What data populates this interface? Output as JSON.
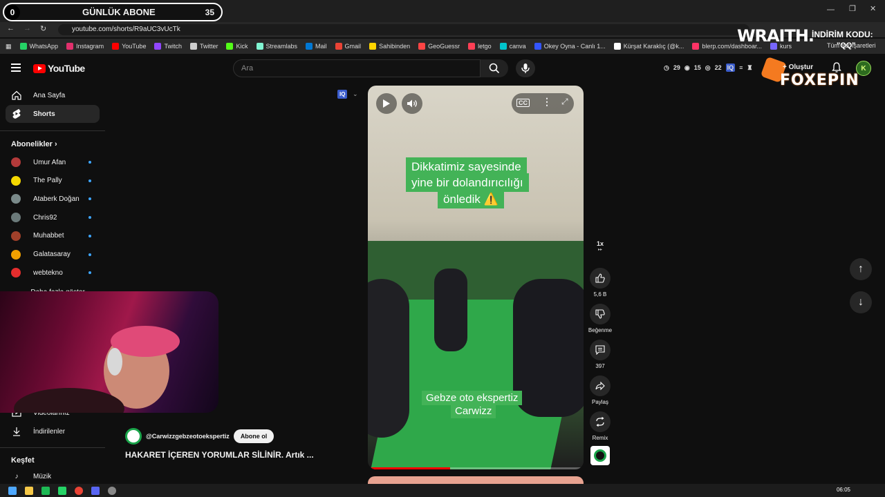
{
  "overlay": {
    "abone_left": "0",
    "abone_title": "GÜNLÜK ABONE",
    "abone_right": "35",
    "tab_title": "HAKARET İÇEREN YORUMLAR ...",
    "wraith": "WRAITH.",
    "indirim": "İNDİRİM KODU:",
    "qq": "\"QQ\"",
    "foxepin": "FOXEPIN"
  },
  "browser": {
    "url": "youtube.com/shorts/R9aUC3vUcTk",
    "bookmarks": [
      {
        "label": "WhatsApp",
        "color": "#25d366"
      },
      {
        "label": "Instagram",
        "color": "#e1306c"
      },
      {
        "label": "YouTube",
        "color": "#ff0000"
      },
      {
        "label": "Twitch",
        "color": "#9146ff"
      },
      {
        "label": "Twitter",
        "color": "#cccccc"
      },
      {
        "label": "Kick",
        "color": "#53fc18"
      },
      {
        "label": "Streamlabs",
        "color": "#80f5d2"
      },
      {
        "label": "Mail",
        "color": "#0078d4"
      },
      {
        "label": "Gmail",
        "color": "#ea4335"
      },
      {
        "label": "Sahibinden",
        "color": "#ffd400"
      },
      {
        "label": "GeoGuessr",
        "color": "#ff4444"
      },
      {
        "label": "letgo",
        "color": "#ff3f55"
      },
      {
        "label": "canva",
        "color": "#00c4cc"
      },
      {
        "label": "Okey Oyna - Canlı 1...",
        "color": "#3355ff"
      },
      {
        "label": "Kürşat Karaklıç (@k...",
        "color": "#ffffff"
      },
      {
        "label": "blerp.com/dashboar...",
        "color": "#ff3366"
      },
      {
        "label": "kurs",
        "color": "#7766ff"
      }
    ],
    "other_bookmarks": "Tüm Yer İşaretleri"
  },
  "header": {
    "logo_text": "YouTube",
    "search_placeholder": "Ara",
    "stat_1": "29",
    "stat_2": "15",
    "stat_3": "22",
    "create_label": "Oluştur",
    "avatar_letter": "K"
  },
  "sidebar": {
    "home": "Ana Sayfa",
    "shorts": "Shorts",
    "subs_heading": "Abonelikler",
    "subscriptions": [
      {
        "name": "Umur Afan",
        "color": "#b33a3a"
      },
      {
        "name": "The Pally",
        "color": "#f5d800"
      },
      {
        "name": "Ataberk Doğan",
        "color": "#7a8a8a"
      },
      {
        "name": "Chris92",
        "color": "#6b7a7a"
      },
      {
        "name": "Muhabbet",
        "color": "#a0402a"
      },
      {
        "name": "Galatasaray",
        "color": "#f0a000"
      },
      {
        "name": "webtekno",
        "color": "#e52d2d"
      }
    ],
    "show_more": "Daha fazla göster",
    "videos": "Videolarınız",
    "downloads": "İndirilenler",
    "explore_heading": "Keşfet",
    "music": "Müzik"
  },
  "video": {
    "caption_top_1": "Dikkatimiz sayesinde",
    "caption_top_2": "yine bir dolandırıcılığı",
    "caption_top_3": "önledik ⚠️",
    "caption_bottom_1": "Gebze oto ekspertiz",
    "caption_bottom_2": "Carwizz",
    "progress": 0.38,
    "channel": "@Carwizzgebzeotoekspertiz",
    "subscribe": "Abone ol",
    "title": "HAKARET İÇEREN YORUMLAR SİLİNİR. Artık ..."
  },
  "actions": {
    "speed": "1x",
    "likes": "5,6 B",
    "dislike": "Beğenme",
    "comments": "397",
    "share": "Paylaş",
    "remix": "Remix"
  },
  "taskbar": {
    "time": "06:05"
  }
}
